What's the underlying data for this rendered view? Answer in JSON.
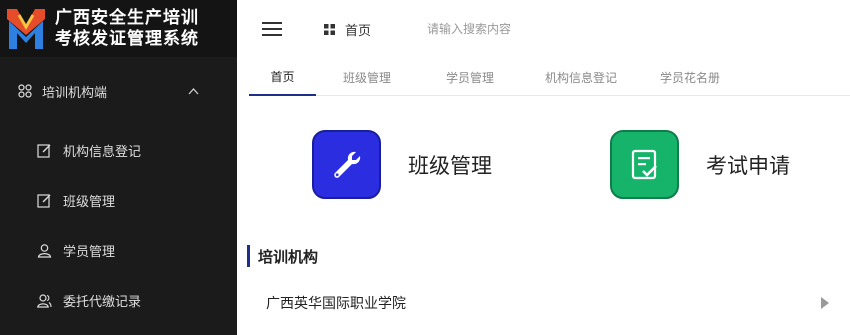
{
  "brand": {
    "line1": "广西安全生产培训",
    "line2": "考核发证管理系统"
  },
  "sidebar": {
    "group_label": "培训机构端",
    "items": [
      {
        "label": "机构信息登记",
        "icon": "edit-icon"
      },
      {
        "label": "班级管理",
        "icon": "edit-icon"
      },
      {
        "label": "学员管理",
        "icon": "user-icon"
      },
      {
        "label": "委托代缴记录",
        "icon": "users-icon"
      }
    ]
  },
  "header": {
    "home_label": "首页",
    "search_placeholder": "请输入搜索内容"
  },
  "tabs": [
    {
      "label": "首页",
      "active": true
    },
    {
      "label": "班级管理"
    },
    {
      "label": "学员管理"
    },
    {
      "label": "机构信息登记"
    },
    {
      "label": "学员花名册"
    }
  ],
  "cards": [
    {
      "label": "班级管理",
      "icon": "wrench-icon",
      "color": "#2a2ee0"
    },
    {
      "label": "考试申请",
      "icon": "document-check-icon",
      "color": "#16b46a"
    }
  ],
  "section": {
    "title": "培训机构",
    "org_name": "广西英华国际职业学院"
  },
  "colors": {
    "sidebar_bg": "#1b1b1b",
    "accent": "#1d2f8a"
  }
}
